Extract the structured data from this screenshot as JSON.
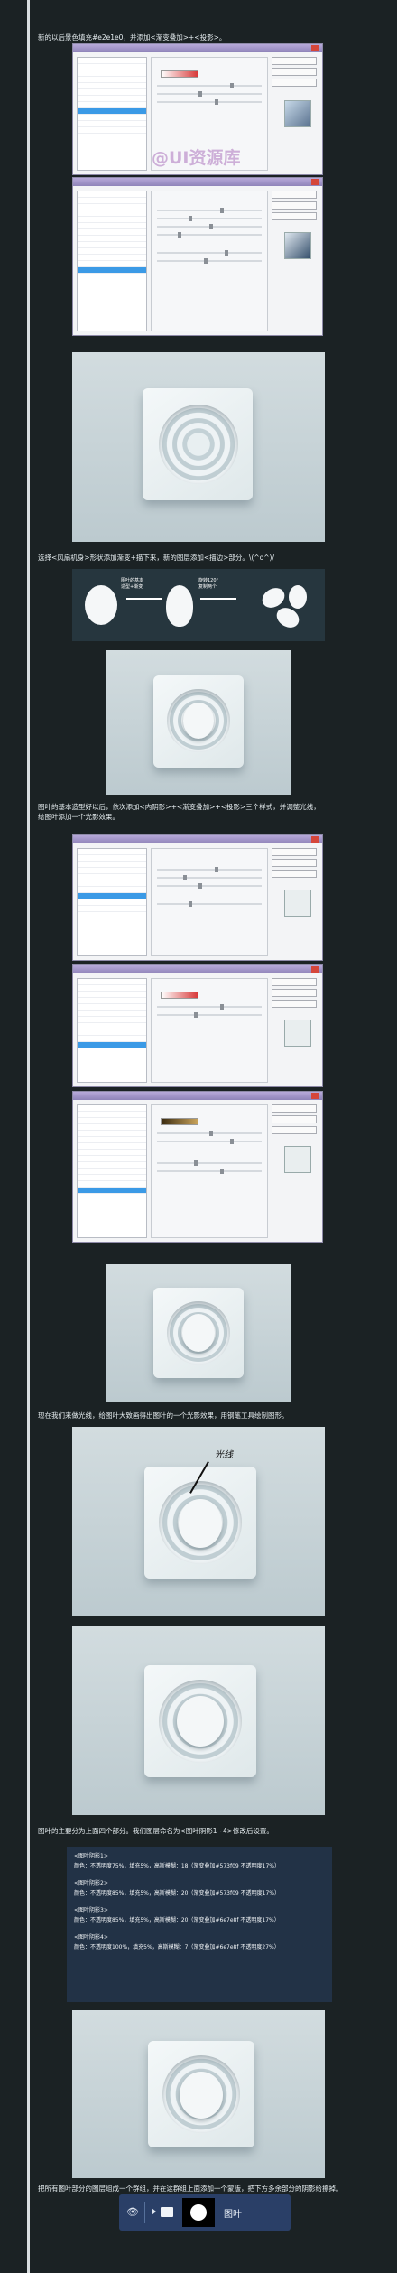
{
  "text": {
    "p1": "新的以后景色填充#e2e1e0，并添加<渐变叠加>+<投影>。",
    "p2": "选择<风扇机身>形状添加渐变+描下来，新的图层添加<描边>部分。\\(^o^)/",
    "p3": "图叶的基本造型好以后，依次添加<内阴影>+<渐变叠加>+<投影>三个样式，并调整光线，给图叶添加一个光影效果。",
    "p4": "现在我们来做光线，给图叶大致画得出图叶的一个光影效果，用钢笔工具绘制图形。",
    "p5": "图叶的主要分为上面四个部分。我们图层命名为<图叶阴影1~4>修改后设置。",
    "p6": "把所有图叶部分的图层组成一个群组，并在这群组上面添加一个蒙版，把下方多余部分的阴影给擦掉。"
  },
  "watermark": "@UI资源库",
  "fan_labels": {
    "arrow1": "图叶的基本\n造型+渐变",
    "arrow2": "旋转120°\n复制两个"
  },
  "annotation": "光线",
  "code_lines": [
    "<图叶阴影1>",
    "颜色：不透明度75%，填充5%，高斯模糊：18（渐变叠加#573f09 不透明度17%）",
    "<图叶阴影2>",
    "颜色：不透明度85%，填充5%，高斯模糊：20（渐变叠加#573f09 不透明度17%）",
    "<图叶阴影3>",
    "颜色：不透明度85%，填充5%，高斯模糊：20（渐变叠加#6e7e8f 不透明度17%）",
    "<图叶阴影4>",
    "颜色：不透明度100%，填充5%，高斯模糊：7（渐变叠加#6e7e8f 不透明度27%）"
  ],
  "layer_panel": {
    "name": "图叶"
  },
  "icons": [
    "eye-icon",
    "folder-icon",
    "disclosure-arrow-icon"
  ]
}
